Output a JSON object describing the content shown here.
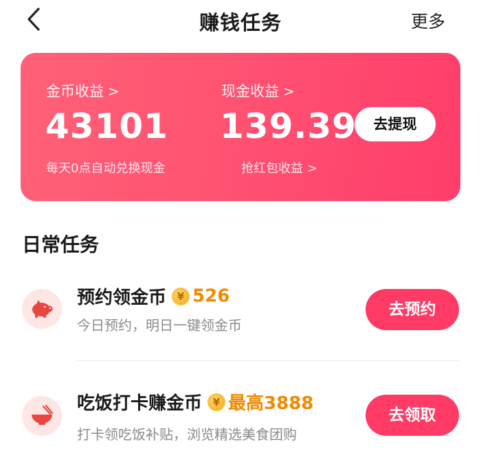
{
  "header": {
    "back_icon": "chevron-left-icon",
    "title": "赚钱任务",
    "more_label": "更多"
  },
  "earnings_card": {
    "gradient_colors": [
      "#ff6178",
      "#ff3d6a"
    ],
    "coins": {
      "label": "金币收益",
      "value": "43101",
      "subtitle": "每天0点自动兑换现金"
    },
    "cash": {
      "label": "现金收益",
      "value": "139.39",
      "subtitle": "抢红包收益"
    },
    "withdraw_button": "去提现"
  },
  "daily_tasks": {
    "section_title": "日常任务",
    "items": [
      {
        "icon": "piggy-bank-icon",
        "title": "预约领金币",
        "coin_symbol": "¥",
        "reward": "526",
        "description": "今日预约，明日一键领金币",
        "button": "去预约"
      },
      {
        "icon": "rice-bowl-icon",
        "title": "吃饭打卡赚金币",
        "coin_symbol": "¥",
        "reward": "最高3888",
        "description": "打卡领吃饭补贴，浏览精选美食团购",
        "button": "去领取"
      }
    ]
  },
  "colors": {
    "accent": "#ff3a64",
    "reward": "#f08a00",
    "icon_bg": "#fde6e4"
  }
}
